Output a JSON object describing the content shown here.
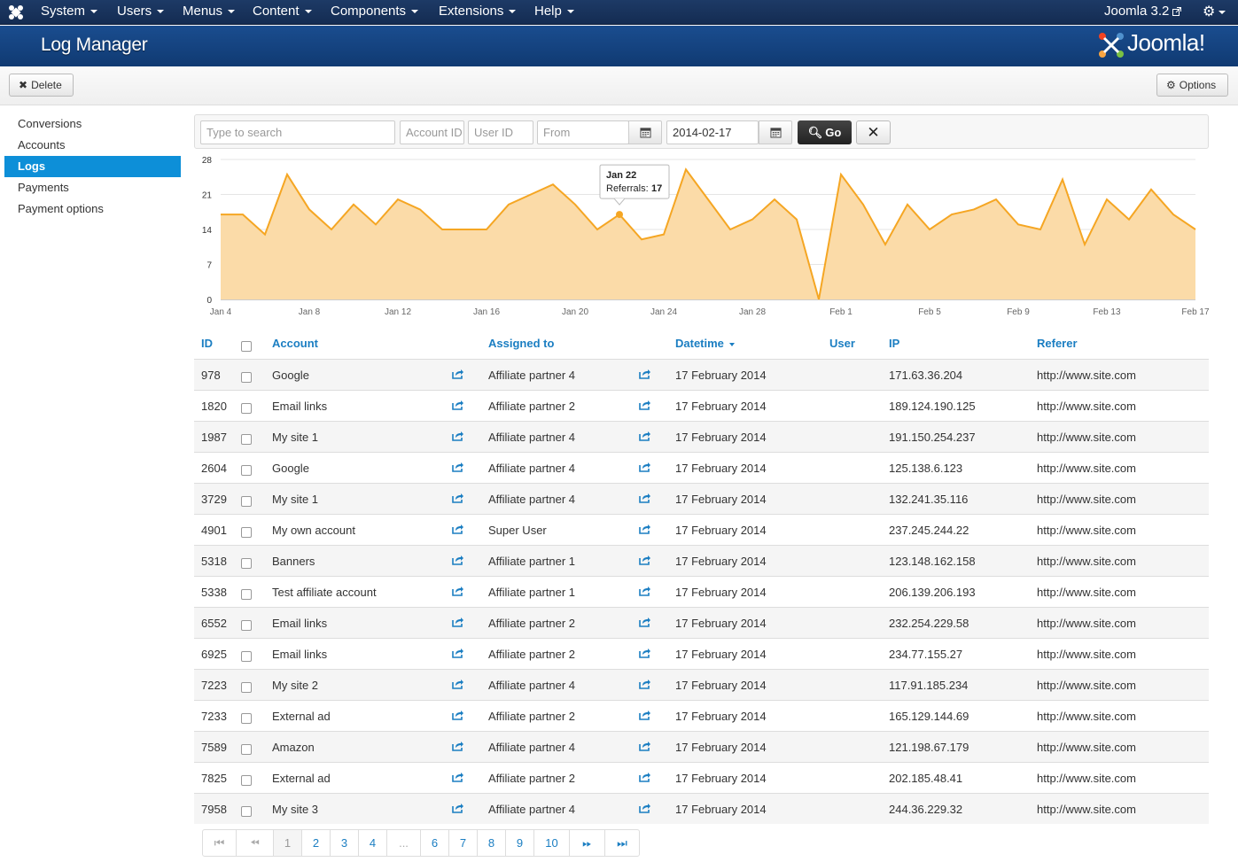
{
  "topnav": {
    "menus": [
      {
        "label": "System"
      },
      {
        "label": "Users"
      },
      {
        "label": "Menus"
      },
      {
        "label": "Content"
      },
      {
        "label": "Components"
      },
      {
        "label": "Extensions"
      },
      {
        "label": "Help"
      }
    ],
    "version": "Joomla 3.2"
  },
  "header": {
    "title": "Log Manager",
    "logo_text": "Joomla!"
  },
  "toolbar": {
    "delete_label": "Delete",
    "options_label": "Options"
  },
  "sidebar": {
    "items": [
      {
        "label": "Conversions",
        "active": false
      },
      {
        "label": "Accounts",
        "active": false
      },
      {
        "label": "Logs",
        "active": true
      },
      {
        "label": "Payments",
        "active": false
      },
      {
        "label": "Payment options",
        "active": false
      }
    ]
  },
  "filters": {
    "search_placeholder": "Type to search",
    "account_id_placeholder": "Account ID",
    "user_id_placeholder": "User ID",
    "from_placeholder": "From",
    "to_value": "2014-02-17",
    "go_label": "Go"
  },
  "chart_data": {
    "type": "area",
    "y_ticks": [
      "0",
      "7",
      "14",
      "21",
      "28"
    ],
    "ylim": [
      0,
      28
    ],
    "x_ticks": [
      "Jan 4",
      "Jan 8",
      "Jan 12",
      "Jan 16",
      "Jan 20",
      "Jan 24",
      "Jan 28",
      "Feb 1",
      "Feb 5",
      "Feb 9",
      "Feb 13",
      "Feb 17"
    ],
    "x": [
      "Jan 4",
      "Jan 5",
      "Jan 6",
      "Jan 7",
      "Jan 8",
      "Jan 9",
      "Jan 10",
      "Jan 11",
      "Jan 12",
      "Jan 13",
      "Jan 14",
      "Jan 15",
      "Jan 16",
      "Jan 17",
      "Jan 18",
      "Jan 19",
      "Jan 20",
      "Jan 21",
      "Jan 22",
      "Jan 23",
      "Jan 24",
      "Jan 25",
      "Jan 26",
      "Jan 27",
      "Jan 28",
      "Jan 29",
      "Jan 30",
      "Jan 31",
      "Feb 1",
      "Feb 2",
      "Feb 3",
      "Feb 4",
      "Feb 5",
      "Feb 6",
      "Feb 7",
      "Feb 8",
      "Feb 9",
      "Feb 10",
      "Feb 11",
      "Feb 12",
      "Feb 13",
      "Feb 14",
      "Feb 15",
      "Feb 16",
      "Feb 17"
    ],
    "values": [
      17,
      17,
      13,
      25,
      18,
      14,
      19,
      15,
      20,
      18,
      14,
      14,
      14,
      19,
      21,
      23,
      19,
      14,
      17,
      12,
      13,
      26,
      20,
      14,
      16,
      20,
      16,
      0,
      25,
      19,
      11,
      19,
      14,
      17,
      18,
      20,
      15,
      14,
      24,
      11,
      20,
      16,
      22,
      17,
      14
    ],
    "line_color": "#f5a623",
    "fill_color": "#fbdba8",
    "tooltip": {
      "date": "Jan 22",
      "label": "Referrals:",
      "value": "17"
    },
    "grid": true
  },
  "table": {
    "headers": {
      "id": "ID",
      "account": "Account",
      "assigned": "Assigned to",
      "datetime": "Datetime",
      "user": "User",
      "ip": "IP",
      "referer": "Referer"
    },
    "rows": [
      {
        "id": "978",
        "account": "Google",
        "assigned": "Affiliate partner 4",
        "datetime": "17 February 2014",
        "ip": "171.63.36.204",
        "referer": "http://www.site.com"
      },
      {
        "id": "1820",
        "account": "Email links",
        "assigned": "Affiliate partner 2",
        "datetime": "17 February 2014",
        "ip": "189.124.190.125",
        "referer": "http://www.site.com"
      },
      {
        "id": "1987",
        "account": "My site 1",
        "assigned": "Affiliate partner 4",
        "datetime": "17 February 2014",
        "ip": "191.150.254.237",
        "referer": "http://www.site.com"
      },
      {
        "id": "2604",
        "account": "Google",
        "assigned": "Affiliate partner 4",
        "datetime": "17 February 2014",
        "ip": "125.138.6.123",
        "referer": "http://www.site.com"
      },
      {
        "id": "3729",
        "account": "My site 1",
        "assigned": "Affiliate partner 4",
        "datetime": "17 February 2014",
        "ip": "132.241.35.116",
        "referer": "http://www.site.com"
      },
      {
        "id": "4901",
        "account": "My own account",
        "assigned": "Super User",
        "datetime": "17 February 2014",
        "ip": "237.245.244.22",
        "referer": "http://www.site.com"
      },
      {
        "id": "5318",
        "account": "Banners",
        "assigned": "Affiliate partner 1",
        "datetime": "17 February 2014",
        "ip": "123.148.162.158",
        "referer": "http://www.site.com"
      },
      {
        "id": "5338",
        "account": "Test affiliate account",
        "assigned": "Affiliate partner 1",
        "datetime": "17 February 2014",
        "ip": "206.139.206.193",
        "referer": "http://www.site.com"
      },
      {
        "id": "6552",
        "account": "Email links",
        "assigned": "Affiliate partner 2",
        "datetime": "17 February 2014",
        "ip": "232.254.229.58",
        "referer": "http://www.site.com"
      },
      {
        "id": "6925",
        "account": "Email links",
        "assigned": "Affiliate partner 2",
        "datetime": "17 February 2014",
        "ip": "234.77.155.27",
        "referer": "http://www.site.com"
      },
      {
        "id": "7223",
        "account": "My site 2",
        "assigned": "Affiliate partner 4",
        "datetime": "17 February 2014",
        "ip": "117.91.185.234",
        "referer": "http://www.site.com"
      },
      {
        "id": "7233",
        "account": "External ad",
        "assigned": "Affiliate partner 2",
        "datetime": "17 February 2014",
        "ip": "165.129.144.69",
        "referer": "http://www.site.com"
      },
      {
        "id": "7589",
        "account": "Amazon",
        "assigned": "Affiliate partner 4",
        "datetime": "17 February 2014",
        "ip": "121.198.67.179",
        "referer": "http://www.site.com"
      },
      {
        "id": "7825",
        "account": "External ad",
        "assigned": "Affiliate partner 2",
        "datetime": "17 February 2014",
        "ip": "202.185.48.41",
        "referer": "http://www.site.com"
      },
      {
        "id": "7958",
        "account": "My site 3",
        "assigned": "Affiliate partner 4",
        "datetime": "17 February 2014",
        "ip": "244.36.229.32",
        "referer": "http://www.site.com"
      }
    ]
  },
  "pagination": {
    "pages": [
      "1",
      "2",
      "3",
      "4",
      "...",
      "6",
      "7",
      "8",
      "9",
      "10"
    ],
    "current": "1"
  },
  "colors": {
    "link": "#1b7ec2",
    "active_nav": "#0d8fd8",
    "header_blue": "#1a4d8f"
  }
}
